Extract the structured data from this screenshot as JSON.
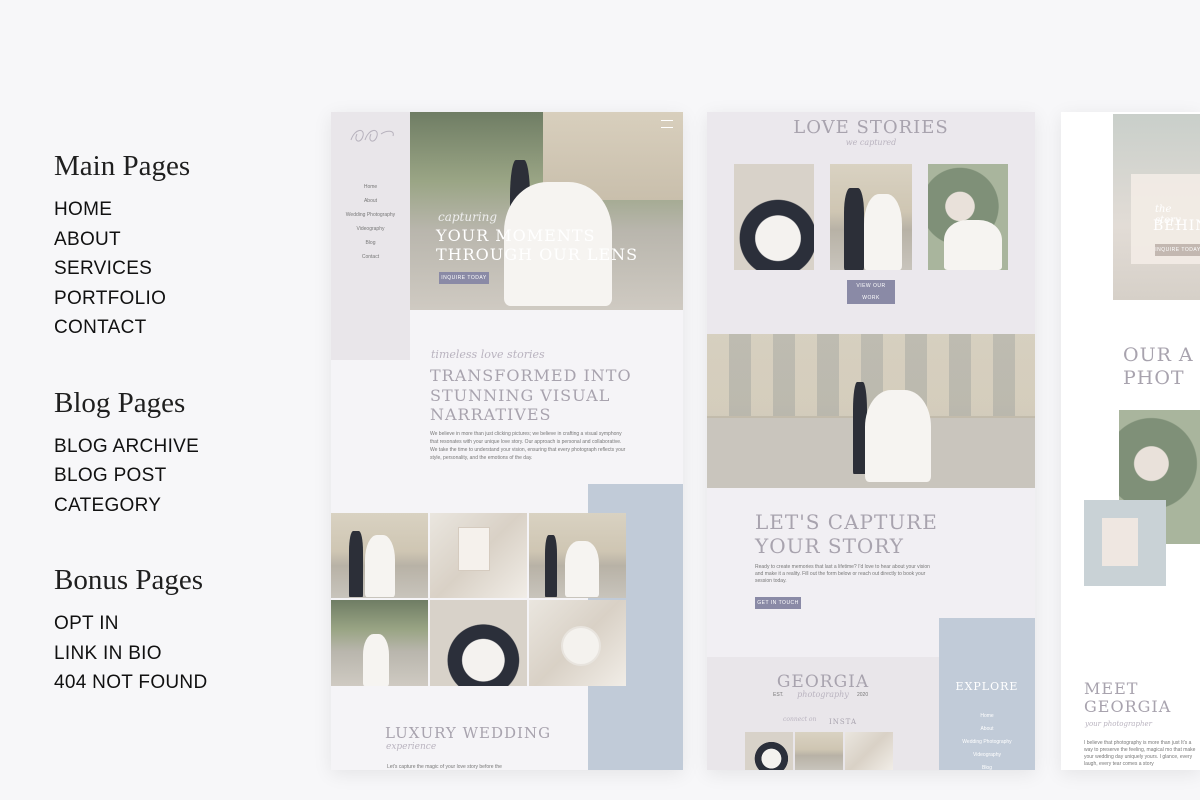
{
  "menu": {
    "main_title": "Main Pages",
    "main_items": [
      "HOME",
      "ABOUT",
      "SERVICES",
      "PORTFOLIO",
      "CONTACT"
    ],
    "blog_title": "Blog Pages",
    "blog_items": [
      "BLOG ARCHIVE",
      "BLOG POST",
      "CATEGORY"
    ],
    "bonus_title": "Bonus Pages",
    "bonus_items": [
      "OPT IN",
      "LINK IN BIO",
      "404 NOT FOUND"
    ]
  },
  "home_mock": {
    "nav": [
      "Home",
      "About",
      "Wedding Photography",
      "Videography",
      "Blog",
      "Contact"
    ],
    "hero_script": "capturing",
    "hero_line1": "YOUR MOMENTS",
    "hero_line2": "THROUGH OUR LENS",
    "hero_button": "INQUIRE TODAY",
    "intro_script": "timeless love stories",
    "intro_line1": "TRANSFORMED INTO",
    "intro_line2": "STUNNING VISUAL",
    "intro_line3": "NARRATIVES",
    "intro_body": "We believe in more than just clicking pictures; we believe in crafting a visual symphony that resonates with your unique love story. Our approach is personal and collaborative. We take the time to understand your vision, ensuring that every photograph reflects your style, personality, and the emotions of the day.",
    "luxury_title": "LUXURY WEDDING",
    "luxury_script": "experience",
    "luxury_body": "Let's capture the magic of your love story before the"
  },
  "portfolio_mock": {
    "title": "LOVE STORIES",
    "script": "we captured",
    "button": "VIEW OUR WORK",
    "cta_line1": "LET'S CAPTURE",
    "cta_line2": "YOUR STORY",
    "cta_body": "Ready to create memories that last a lifetime? I'd love to hear about your vision and make it a reality. Fill out the form below or reach out directly to book your session today.",
    "cta_button": "GET IN TOUCH",
    "brand_name": "GEORGIA",
    "brand_est": "EST.",
    "brand_year": "2020",
    "brand_script": "photography",
    "insta_script": "connect on",
    "insta_label": "INSTA",
    "explore_title": "EXPLORE",
    "explore_items": [
      "Home",
      "About",
      "Wedding Photography",
      "Videography",
      "Blog"
    ]
  },
  "about_mock": {
    "hero_script": "the story",
    "hero_word": "BEHIN",
    "hero_button": "INQUIRE TODAY",
    "title_line1": "OUR A",
    "title_line2": "PHOT",
    "meet_line1": "MEET",
    "meet_line2": "GEORGIA",
    "meet_script": "your photographer",
    "meet_body": "I believe that photography is more than just It's a way to preserve the feeling, magical mo that make your wedding day uniquely yours. I glance, every laugh, every tear comes a story"
  },
  "colors": {
    "accent_button": "#8a8aa6",
    "dusty_blue": "#c1cbd8",
    "lavender_panel": "#ebe8ed"
  }
}
